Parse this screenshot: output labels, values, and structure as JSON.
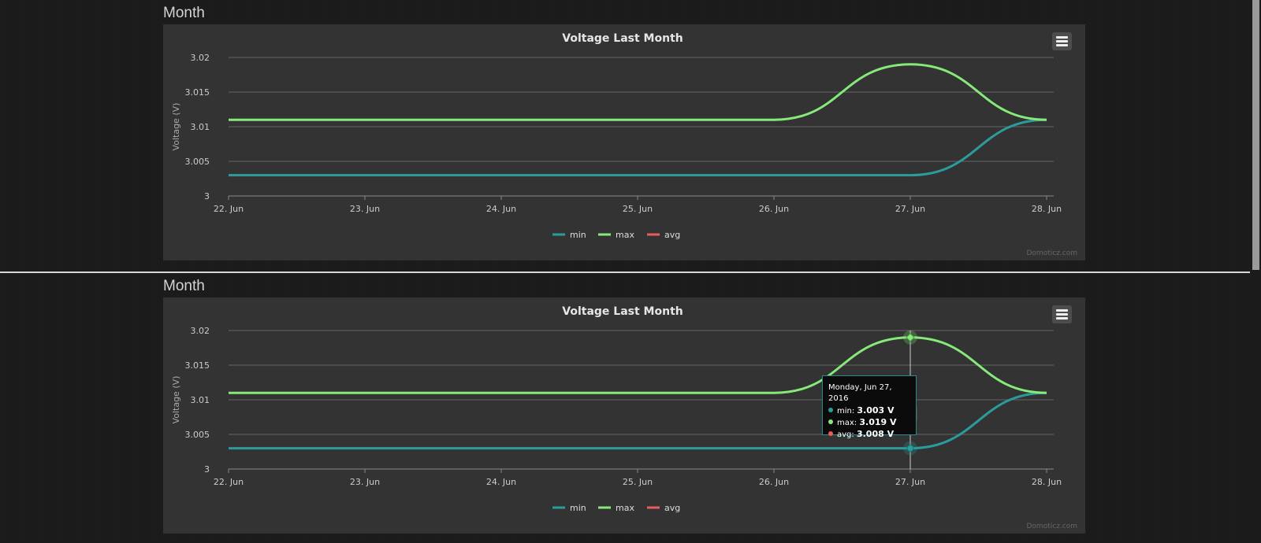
{
  "panels": [
    {
      "section_title": "Month",
      "chart_title": "Voltage Last Month",
      "show_tooltip": false
    },
    {
      "section_title": "Month",
      "chart_title": "Voltage Last Month",
      "show_tooltip": true
    }
  ],
  "credits": "Domoticz.com",
  "tooltip": {
    "date": "Monday, Jun 27, 2016",
    "rows": [
      {
        "name": "min",
        "value": "3.003 V",
        "color": "#2b9c9b"
      },
      {
        "name": "max",
        "value": "3.019 V",
        "color": "#86e97a"
      },
      {
        "name": "avg",
        "value": "3.008 V",
        "color": "#e85c5c"
      }
    ]
  },
  "colors": {
    "min": "#2b9c9b",
    "max": "#86e97a",
    "avg": "#e85c5c",
    "plot_bg": "#333333",
    "grid": "#666666"
  },
  "chart_data": {
    "type": "line",
    "title": "Voltage Last Month",
    "ylabel": "Voltage (V)",
    "xlabel": "",
    "ylim": [
      3,
      3.02
    ],
    "y_ticks": [
      "3",
      "3.005",
      "3.01",
      "3.015",
      "3.02"
    ],
    "categories": [
      "22. Jun",
      "23. Jun",
      "24. Jun",
      "25. Jun",
      "26. Jun",
      "27. Jun",
      "28. Jun"
    ],
    "series": [
      {
        "name": "min",
        "values": [
          3.003,
          3.003,
          3.003,
          3.003,
          3.003,
          3.003,
          3.011
        ]
      },
      {
        "name": "max",
        "values": [
          3.011,
          3.011,
          3.011,
          3.011,
          3.011,
          3.019,
          3.011
        ]
      },
      {
        "name": "avg",
        "values": [
          null,
          null,
          null,
          null,
          null,
          3.008,
          null
        ]
      }
    ],
    "grid": true,
    "legend_position": "bottom-center"
  },
  "menu_icon": "hamburger-menu-icon"
}
